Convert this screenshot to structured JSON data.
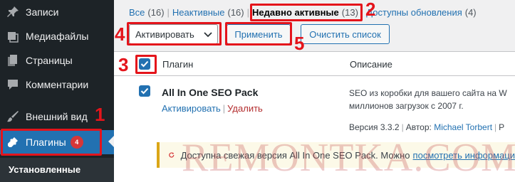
{
  "sidebar": {
    "items": [
      {
        "label": "Записи",
        "icon": "pushpin-icon"
      },
      {
        "label": "Медиафайлы",
        "icon": "media-icon"
      },
      {
        "label": "Страницы",
        "icon": "pages-icon"
      },
      {
        "label": "Комментарии",
        "icon": "comment-icon"
      },
      {
        "label": "Внешний вид",
        "icon": "paintbrush-icon"
      },
      {
        "label": "Плагины",
        "icon": "plugin-icon",
        "badge": "4",
        "active": true
      }
    ],
    "submenu": {
      "label": "Установленные"
    }
  },
  "filters": {
    "all": {
      "label": "Все",
      "count": "(16)"
    },
    "inactive": {
      "label": "Неактивные",
      "count": "(16)"
    },
    "recent": {
      "label": "Недавно активные",
      "count": "(13)"
    },
    "updates": {
      "label": "Доступны обновления",
      "count": "(4)"
    }
  },
  "bulk": {
    "select_value": "Активировать",
    "apply_label": "Применить",
    "clear_label": "Очистить список"
  },
  "table": {
    "col_plugin": "Плагин",
    "col_description": "Описание",
    "row": {
      "name": "All In One SEO Pack",
      "activate": "Активировать",
      "delete": "Удалить",
      "desc_line1": "SEO из коробки для вашего сайта на W",
      "desc_line2": "миллионов загрузок с 2007 г.",
      "version": "Версия 3.3.2",
      "author_prefix": "Автор:",
      "author": "Michael Torbert",
      "author_suffix": "Р"
    },
    "update_notice": {
      "text": "Доступна свежая версия All In One SEO Pack. Можно",
      "link": "посмотреть информаци"
    }
  },
  "annotations": {
    "n1": "1",
    "n2": "2",
    "n3": "3",
    "n4": "4",
    "n5": "5"
  },
  "watermark": "REMONTKA.COM",
  "colors": {
    "accent": "#2271b1",
    "sidebar": "#1d2327",
    "annotation": "#e4141b",
    "notice": "#dba617"
  }
}
